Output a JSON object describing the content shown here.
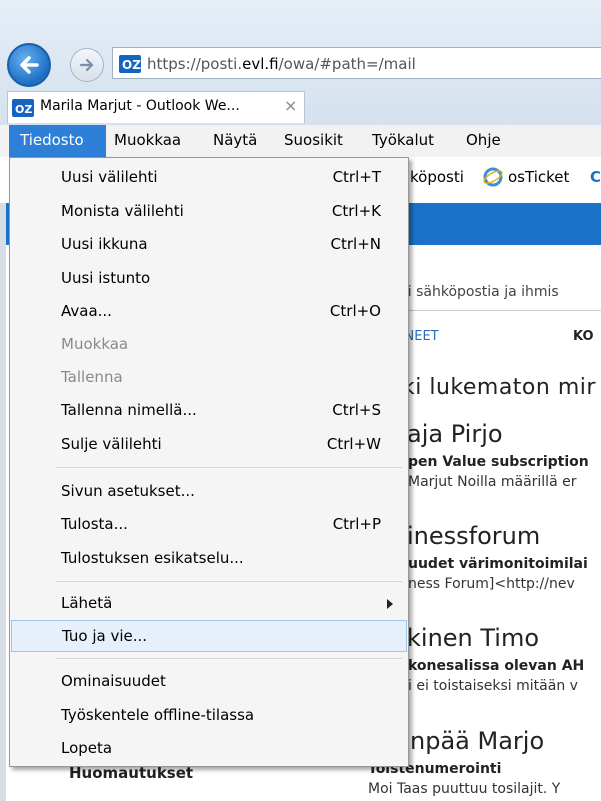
{
  "browser": {
    "url_prefix": "https://posti.",
    "url_domain": "evl.fi",
    "url_suffix": "/owa/#path=/mail",
    "tab_title": "Marila Marjut - Outlook We...",
    "tab_close": "×"
  },
  "menubar": {
    "items": [
      "Tiedosto",
      "Muokkaa",
      "Näytä",
      "Suosikit",
      "Työkalut",
      "Ohje"
    ]
  },
  "favorites": {
    "item1": "köposti",
    "item2": "osTicket",
    "item3": "C"
  },
  "file_menu": {
    "items": [
      {
        "label": "Uusi välilehti",
        "shortcut": "Ctrl+T"
      },
      {
        "label": "Monista välilehti",
        "shortcut": "Ctrl+K"
      },
      {
        "label": "Uusi ikkuna",
        "shortcut": "Ctrl+N"
      },
      {
        "label": "Uusi istunto",
        "shortcut": ""
      },
      {
        "label": "Avaa...",
        "shortcut": "Ctrl+O"
      },
      {
        "label": "Muokkaa",
        "shortcut": ""
      },
      {
        "label": "Tallenna",
        "shortcut": ""
      },
      {
        "label": "Tallenna nimellä...",
        "shortcut": "Ctrl+S"
      },
      {
        "label": "Sulje välilehti",
        "shortcut": "Ctrl+W"
      },
      {
        "label": "Sivun asetukset...",
        "shortcut": ""
      },
      {
        "label": "Tulosta...",
        "shortcut": "Ctrl+P"
      },
      {
        "label": "Tulostuksen esikatselu...",
        "shortcut": ""
      },
      {
        "label": "Lähetä",
        "shortcut": ""
      },
      {
        "label": "Tuo ja vie...",
        "shortcut": ""
      },
      {
        "label": "Ominaisuudet",
        "shortcut": ""
      },
      {
        "label": "Työskentele offline-tilassa",
        "shortcut": ""
      },
      {
        "label": "Lopeta",
        "shortcut": ""
      }
    ]
  },
  "outlook": {
    "search_placeholder": "tsi sähköpostia ja ihmis",
    "tab_a": "UNEET",
    "tab_b": "KO",
    "unread_line": "ki  lukematon  mir",
    "messages": [
      {
        "sender": "aja Pirjo",
        "subject": "pen Value subscription",
        "preview": "Marjut Noilla määrillä er"
      },
      {
        "sender": "inessforum",
        "subject": "uudet värimonitoimilai",
        "preview": "ness Forum]<http://nev"
      },
      {
        "sender": "kinen Timo",
        "subject": "konesalissa olevan AH",
        "preview": "i ei toistaiseksi mitään v"
      },
      {
        "sender": "npää Marjo",
        "subject": "Toistenumerointi",
        "preview": "Moi Taas puuttuu tosilajit. Y"
      }
    ],
    "notes_label": "Huomautukset"
  }
}
